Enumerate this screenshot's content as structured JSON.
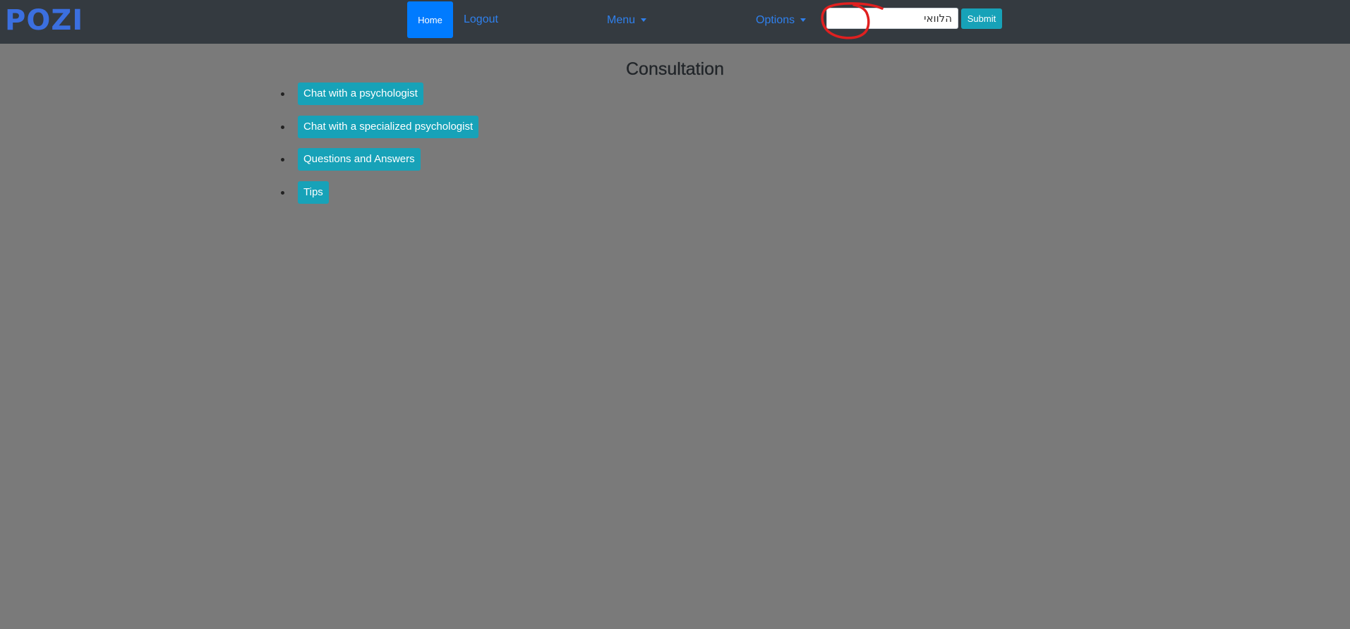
{
  "brand": {
    "logo_text": "POZI",
    "color": "#3b6fe0"
  },
  "nav": {
    "home_label": "Home",
    "logout_label": "Logout",
    "menu_label": "Menu",
    "options_label": "Options",
    "search": {
      "value": "הלוואי",
      "placeholder": ""
    },
    "submit_label": "Submit"
  },
  "annotation": {
    "shape": "hand-drawn circle around search input",
    "color": "#e02020"
  },
  "page": {
    "title": "Consultation",
    "links": [
      {
        "label": "Chat with a psychologist"
      },
      {
        "label": "Chat with a specialized psychologist"
      },
      {
        "label": "Questions and Answers"
      },
      {
        "label": "Tips"
      }
    ]
  },
  "colors": {
    "navbar_bg": "#343a40",
    "page_bg": "#7a7a7a",
    "primary": "#007bff",
    "info": "#17a2b8",
    "link": "#2f80ed"
  }
}
